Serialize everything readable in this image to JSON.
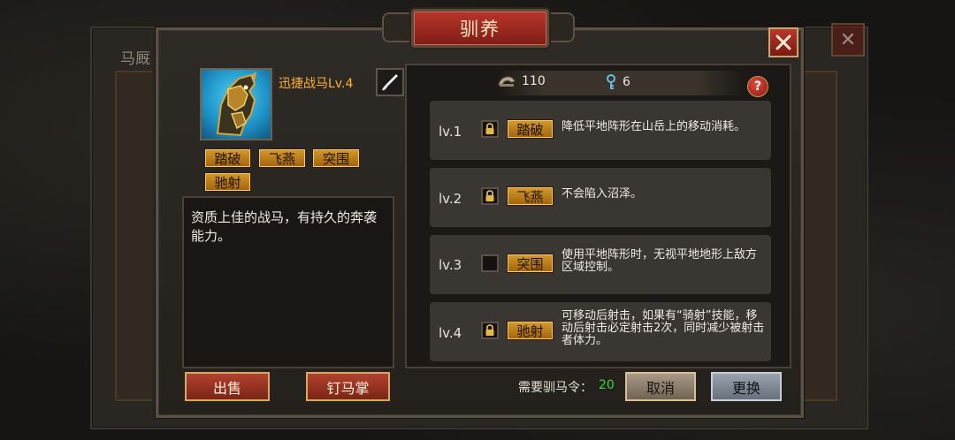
{
  "dialog": {
    "title": "驯养",
    "background_title": "马厩"
  },
  "horse": {
    "name": "迅捷战马Lv.4",
    "description": "资质上佳的战马，有持久的奔袭能力。",
    "tags": [
      "踏破",
      "飞燕",
      "突围",
      "驰射"
    ]
  },
  "resources": {
    "food_value": "110",
    "key_value": "6"
  },
  "skills": [
    {
      "level": "lv.1",
      "name": "踏破",
      "locked": true,
      "description": "降低平地阵形在山岳上的移动消耗。"
    },
    {
      "level": "lv.2",
      "name": "飞燕",
      "locked": true,
      "description": "不会陷入沼泽。"
    },
    {
      "level": "lv.3",
      "name": "突围",
      "locked": false,
      "description": "使用平地阵形时，无视平地地形上敌方区域控制。"
    },
    {
      "level": "lv.4",
      "name": "驰射",
      "locked": true,
      "description": "可移动后射击，如果有“骑射”技能，移动后射击必定射击2次，同时减少被射击者体力。"
    }
  ],
  "footer": {
    "sell_label": "出售",
    "shoe_label": "钉马掌",
    "need_label": "需要驯马令：",
    "need_value": "20",
    "cancel_label": "取消",
    "replace_label": "更换"
  },
  "colors": {
    "accent_gold": "#d49a2d",
    "title_red": "#b8342a",
    "name_orange": "#ffb02e",
    "need_green": "#3fd23f"
  },
  "icons": {
    "close": "close-icon",
    "edit": "brush-icon",
    "food": "horseshoe-icon",
    "key": "key-icon",
    "help": "question-icon",
    "lock": "lock-icon"
  }
}
